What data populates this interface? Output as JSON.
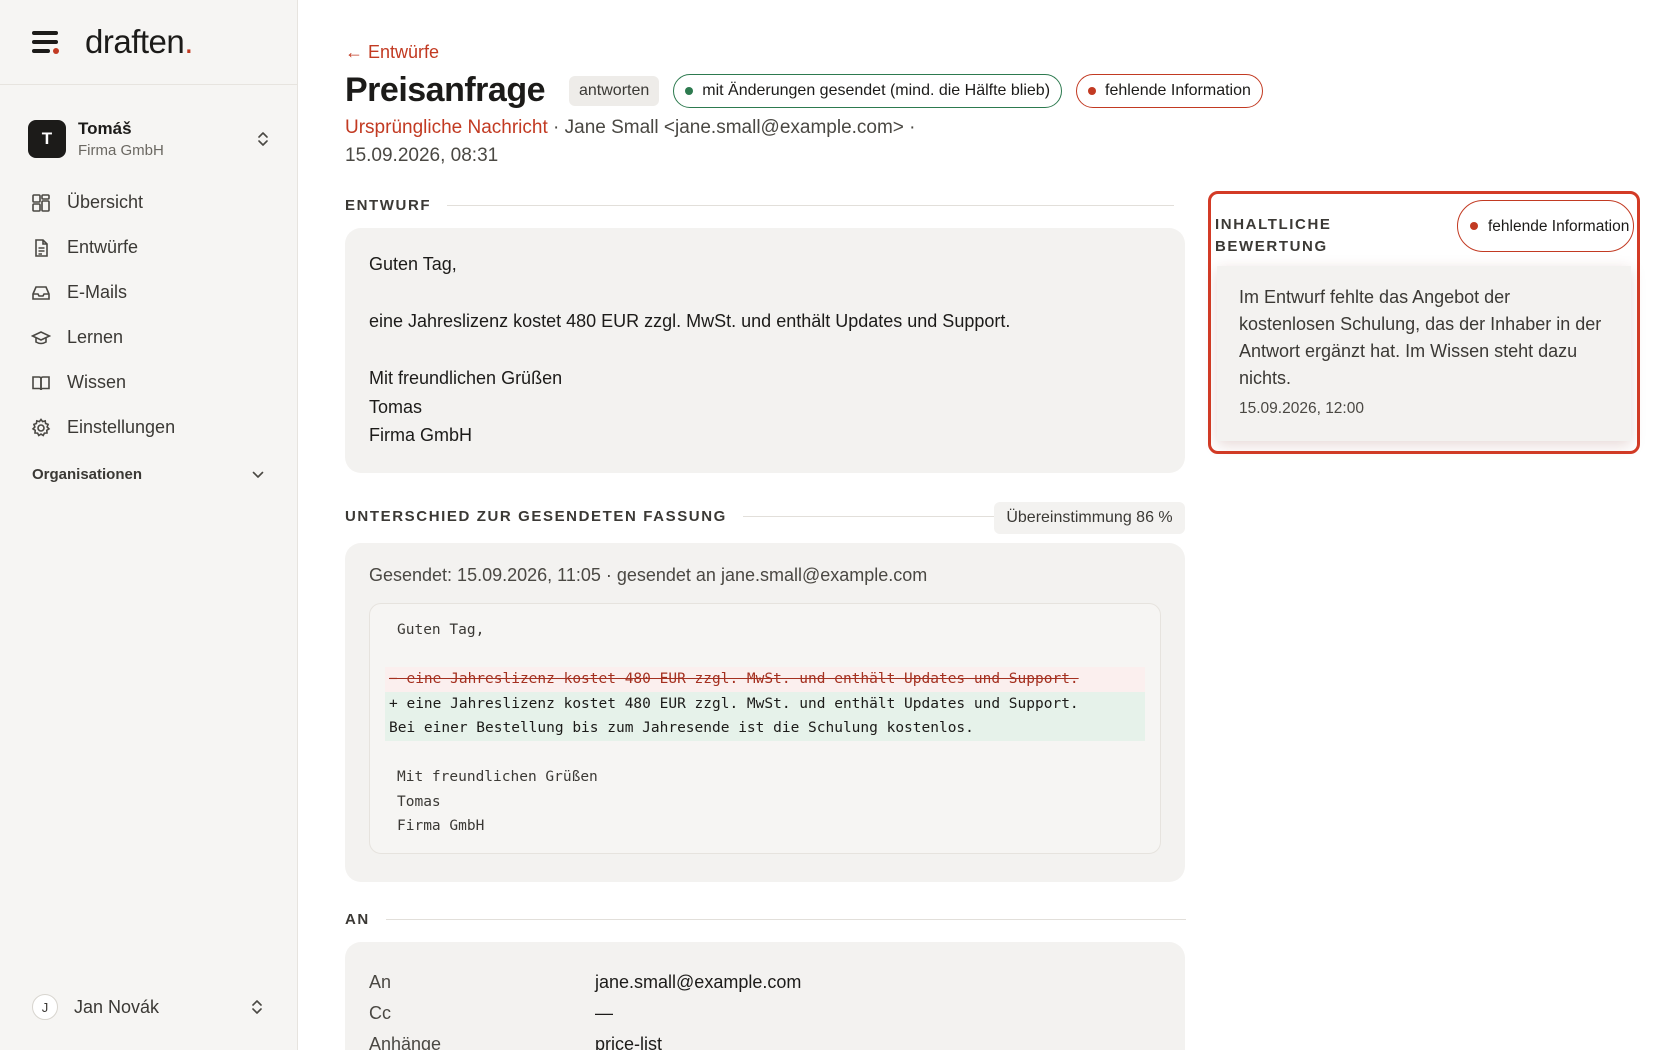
{
  "brand": {
    "logo": "draften",
    "logo_dot": "."
  },
  "workspace": {
    "avatar": "T",
    "name": "Tomáš",
    "org": "Firma GmbH"
  },
  "nav": [
    {
      "label": "Übersicht",
      "icon": "grid-icon"
    },
    {
      "label": "Entwürfe",
      "icon": "document-icon"
    },
    {
      "label": "E-Mails",
      "icon": "inbox-icon"
    },
    {
      "label": "Lernen",
      "icon": "graduation-cap-icon"
    },
    {
      "label": "Wissen",
      "icon": "book-icon"
    },
    {
      "label": "Einstellungen",
      "icon": "gear-icon"
    }
  ],
  "organizations": {
    "label": "Organisationen"
  },
  "user": {
    "avatar": "J",
    "name": "Jan Novák"
  },
  "header": {
    "back": "← Entwürfe",
    "title": "Preisanfrage",
    "type_tag": "antworten",
    "status_sent": "mit Änderungen gesendet (mind. die Hälfte blieb)",
    "status_issue": "fehlende Information",
    "meta_original": "Ursprüngliche Nachricht",
    "meta_rest": " · Jane Small <jane.small@example.com> · 15.09.2026, 08:31"
  },
  "draft": {
    "label": "ENTWURF",
    "greeting": "Guten Tag,",
    "body": "eine Jahreslizenz kostet 480 EUR zzgl. MwSt. und enthält Updates und Support.",
    "closing": "Mit freundlichen Grüßen",
    "sign_name": "Tomas",
    "sign_org": "Firma GmbH"
  },
  "diff": {
    "label": "UNTERSCHIED ZUR GESENDETEN FASSUNG",
    "match": "Übereinstimmung 86 %",
    "sent_info": "Gesendet: 15.09.2026, 11:05 · gesendet an jane.small@example.com",
    "lines": {
      "l1": "Guten Tag,",
      "del": "− eine Jahreslizenz kostet 480 EUR zzgl. MwSt. und enthält Updates und Support.",
      "add1": "+ eine Jahreslizenz kostet 480 EUR zzgl. MwSt. und enthält Updates und Support.",
      "add2": "Bei einer Bestellung bis zum Jahresende ist die Schulung kostenlos.",
      "l5": "Mit freundlichen Grüßen",
      "l6": "Tomas",
      "l7": "Firma GmbH"
    }
  },
  "recipients": {
    "label": "AN",
    "to_label": "An",
    "to_value": "jane.small@example.com",
    "cc_label": "Cc",
    "cc_value": "—",
    "att_label": "Anhänge",
    "att_value": "price-list"
  },
  "assessment": {
    "label": "INHALTLICHE BEWERTUNG",
    "badge": "fehlende Information",
    "text": "Im Entwurf fehlte das Angebot der kostenlosen Schulung, das der Inhaber in der Antwort ergänzt hat. Im Wissen steht dazu nichts.",
    "date": "15.09.2026, 12:00"
  },
  "colors": {
    "accent": "#c23a22",
    "positive": "#2d7a4f",
    "surface": "#f3f2f0"
  }
}
